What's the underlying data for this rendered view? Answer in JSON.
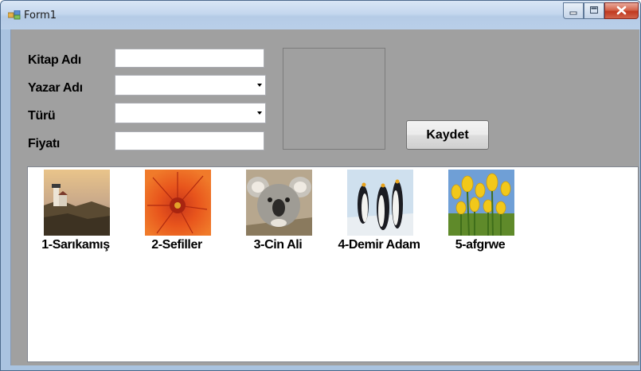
{
  "window": {
    "title": "Form1",
    "controls": {
      "minimize": "minimize",
      "maximize": "maximize",
      "close": "close"
    }
  },
  "form": {
    "fields": [
      {
        "label": "Kitap Adı",
        "type": "textbox",
        "value": ""
      },
      {
        "label": "Yazar Adı",
        "type": "combobox",
        "value": ""
      },
      {
        "label": "Türü",
        "type": "combobox",
        "value": ""
      },
      {
        "label": "Fiyatı",
        "type": "textbox",
        "value": ""
      }
    ],
    "save_button": "Kaydet"
  },
  "list": {
    "items": [
      {
        "label": "1-Sarıkamış",
        "image": "lighthouse"
      },
      {
        "label": "2-Sefiller",
        "image": "chrysanthemum"
      },
      {
        "label": "3-Cin Ali",
        "image": "koala"
      },
      {
        "label": "4-Demir Adam",
        "image": "penguins"
      },
      {
        "label": "5-afgrwe",
        "image": "tulips"
      }
    ]
  },
  "colors": {
    "client_background": "#a0a0a0",
    "titlebar": "#c4d7ee",
    "close_button": "#c0391f"
  }
}
